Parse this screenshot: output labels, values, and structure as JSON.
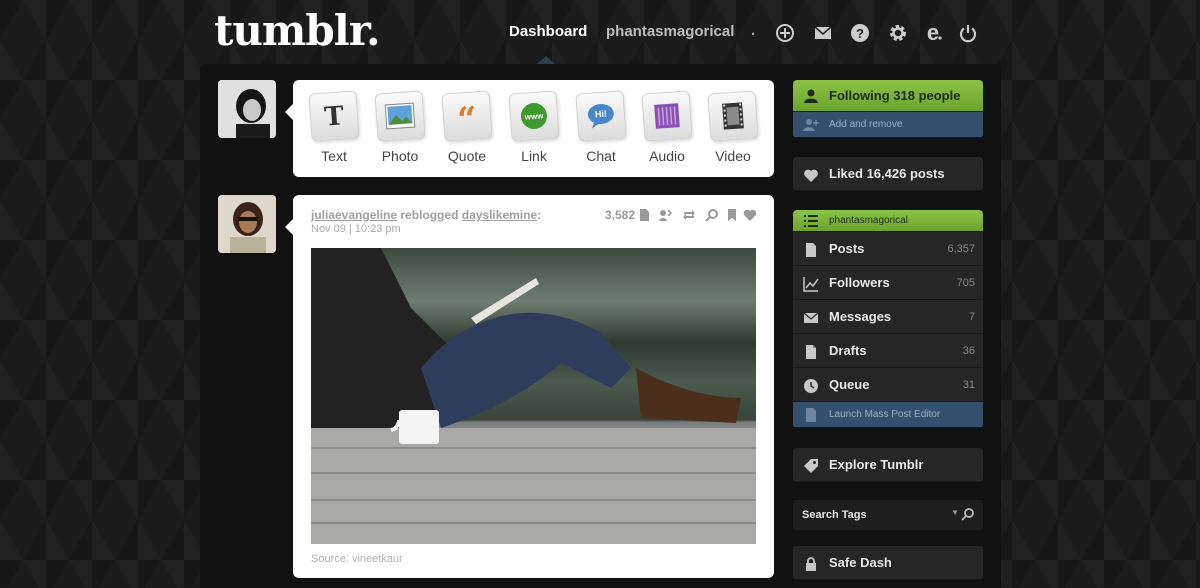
{
  "header": {
    "logo": "tumblr.",
    "nav_dashboard": "Dashboard",
    "nav_blog": "phantasmagorical",
    "nav_dot": ".",
    "icons": [
      "plus-circle-icon",
      "mail-icon",
      "help-icon",
      "gear-icon",
      "e-icon",
      "power-icon"
    ]
  },
  "post_types": [
    {
      "label": "Text",
      "icon": "text-icon"
    },
    {
      "label": "Photo",
      "icon": "photo-icon"
    },
    {
      "label": "Quote",
      "icon": "quote-icon"
    },
    {
      "label": "Link",
      "icon": "link-icon"
    },
    {
      "label": "Chat",
      "icon": "chat-icon"
    },
    {
      "label": "Audio",
      "icon": "audio-icon"
    },
    {
      "label": "Video",
      "icon": "video-icon"
    }
  ],
  "post": {
    "author": "juliaevangeline",
    "action": "reblogged",
    "source_blog": "dayslikemine",
    "colon": ":",
    "date": "Nov 09 | 10:23 pm",
    "notes": "3,582",
    "source_label": "Source: vineetkaur"
  },
  "sidebar": {
    "following": "Following 318 people",
    "add_remove": "Add and remove",
    "liked": "Liked 16,426 posts",
    "blog_name": "phantasmagorical",
    "items": [
      {
        "label": "Posts",
        "count": "6,357",
        "icon": "document-icon"
      },
      {
        "label": "Followers",
        "count": "705",
        "icon": "chart-icon"
      },
      {
        "label": "Messages",
        "count": "7",
        "icon": "mail-icon"
      },
      {
        "label": "Drafts",
        "count": "36",
        "icon": "draft-icon"
      },
      {
        "label": "Queue",
        "count": "31",
        "icon": "clock-icon"
      }
    ],
    "mass_editor": "Launch Mass Post Editor",
    "explore": "Explore Tumblr",
    "search_tags": "Search Tags",
    "search_arrow": "▼",
    "safe_dash": "Safe Dash"
  },
  "colors": {
    "background": "#1c1c1c",
    "green": "#7bb13a",
    "blue": "#34506f"
  }
}
